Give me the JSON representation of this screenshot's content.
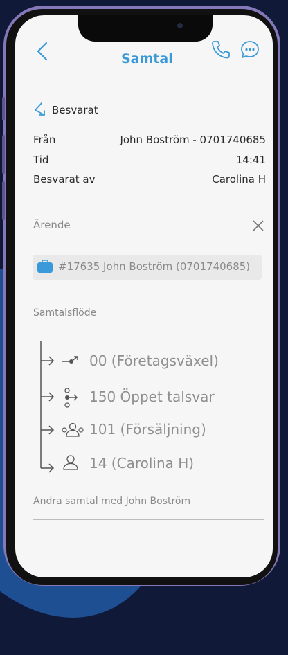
{
  "header": {
    "title": "Samtal"
  },
  "status": {
    "label": "Besvarat"
  },
  "details": {
    "from_label": "Från",
    "from_value": "John Boström - 0701740685",
    "time_label": "Tid",
    "time_value": "14:41",
    "answered_by_label": "Besvarat av",
    "answered_by_value": "Carolina H"
  },
  "case": {
    "placeholder": "Ärende",
    "chip_text": "#17635 John Boström (0701740685)"
  },
  "call_flow": {
    "heading": "Samtalsflöde",
    "steps": [
      {
        "label": "00 (Företagsväxel)",
        "icon": "switchboard-icon"
      },
      {
        "label": "150 Öppet talsvar",
        "icon": "voice-response-icon"
      },
      {
        "label": "101 (Försäljning)",
        "icon": "group-icon"
      },
      {
        "label": "14 (Carolina H)",
        "icon": "person-icon"
      }
    ]
  },
  "other_calls": {
    "heading": "Andra samtal med John Boström"
  },
  "colors": {
    "accent": "#3a9ad9",
    "frame": "#8578b8",
    "background": "#f6f6f6"
  }
}
